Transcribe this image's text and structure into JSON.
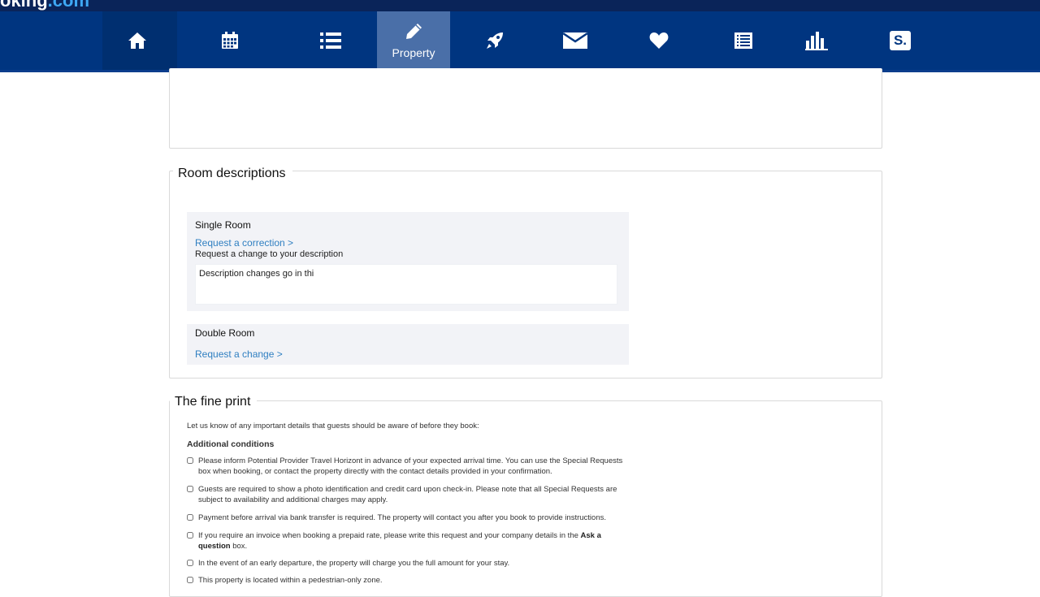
{
  "brand": {
    "logo_main": "oking",
    "logo_suffix": ".com",
    "accent": "#3ea8f4",
    "nav_bg": "#003580"
  },
  "nav": {
    "items": [
      {
        "icon": "home-icon",
        "label": ""
      },
      {
        "icon": "calendar-icon",
        "label": ""
      },
      {
        "icon": "list-icon",
        "label": ""
      },
      {
        "icon": "pencil-icon",
        "label": "Property",
        "active": true
      },
      {
        "icon": "rocket-icon",
        "label": ""
      },
      {
        "icon": "envelope-icon",
        "label": ""
      },
      {
        "icon": "heart-icon",
        "label": ""
      },
      {
        "icon": "document-list-icon",
        "label": ""
      },
      {
        "icon": "bar-chart-icon",
        "label": ""
      },
      {
        "icon": "s-badge-icon",
        "label": "S."
      }
    ]
  },
  "room_descriptions": {
    "title": "Room descriptions",
    "rooms": [
      {
        "name": "Single Room",
        "link": "Request a correction >",
        "hint": "Request a change to your description",
        "textarea_value": "Description changes go in thi"
      },
      {
        "name": "Double Room",
        "link": "Request a change >"
      }
    ]
  },
  "fine_print": {
    "title": "The fine print",
    "intro": "Let us know of any important details that guests should be aware of before they book:",
    "additional_heading": "Additional conditions",
    "conditions": [
      {
        "text": "Please inform Potential Provider Travel Horizont in advance of your expected arrival time. You can use the Special Requests box when booking, or contact the property directly with the contact details provided in your confirmation."
      },
      {
        "text": "Guests are required to show a photo identification and credit card upon check-in. Please note that all Special Requests are subject to availability and additional charges may apply."
      },
      {
        "text": "Payment before arrival via bank transfer is required. The property will contact you after you book to provide instructions."
      },
      {
        "text_before": "If you require an invoice when booking a prepaid rate, please write this request and your company details in the ",
        "bold": "Ask a question",
        "text_after": " box."
      },
      {
        "text": "In the event of an early departure, the property will charge you the full amount for your stay."
      },
      {
        "text": "This property is located within a pedestrian-only zone."
      }
    ]
  }
}
